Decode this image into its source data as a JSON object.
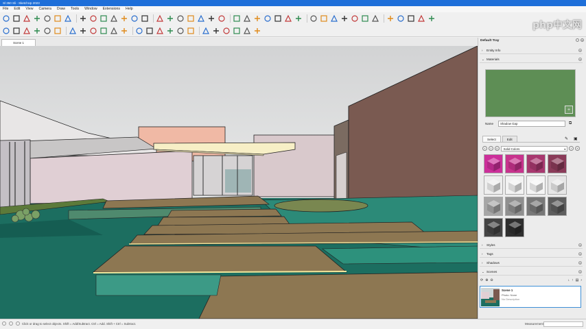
{
  "window": {
    "title": "Sl 350 Sli - SketchUp 2023"
  },
  "menu": [
    "File",
    "Edit",
    "View",
    "Camera",
    "Draw",
    "Tools",
    "Window",
    "Extensions",
    "Help"
  ],
  "toolbar1_icons": [
    "select-icon",
    "paint-icon",
    "eraser-icon",
    "line-icon",
    "arc-icon",
    "rectangle-icon",
    "push-pull-icon",
    "move-icon",
    "rotate-icon",
    "scale-icon",
    "offset-icon",
    "tape-icon",
    "text-icon",
    "orbit-icon",
    "pan-icon",
    "zoom-icon",
    "zoom-extents-icon",
    "walk-icon",
    "position-camera-icon",
    "look-around-icon",
    "section-plane-icon",
    "new-icon",
    "open-icon",
    "save-icon",
    "user-icon",
    "folder-icon",
    "sandbox-icon",
    "eye-icon",
    "water-drop-icon",
    "water-drop-icon",
    "layers-icon",
    "flip-icon",
    "solid-tools-icon",
    "follow-me-icon",
    "intersect-icon",
    "scenes-icon",
    "styles-icon",
    "warehouse-icon",
    "extension-icon",
    "settings-icon"
  ],
  "toolbar2_icons": [
    "brush-icon",
    "camera-icon",
    "component-icon",
    "group-icon",
    "box-icon",
    "iso-view-icon",
    "top-view-icon",
    "front-view-icon",
    "right-view-icon",
    "back-view-icon",
    "left-view-icon",
    "xray-icon",
    "wireframe-icon",
    "hidden-line-icon",
    "shaded-icon",
    "textured-icon",
    "monochrome-icon",
    "geo-icon",
    "help-icon",
    "dot-icon",
    "line-icon",
    "square-icon",
    "circle-icon",
    "no-icon"
  ],
  "scene_tab": "Scene 1",
  "tray": {
    "title": "Default Tray",
    "sections": {
      "entity_info": "Entity Info",
      "materials": "Materials",
      "styles": "Styles",
      "tags": "Tags",
      "shadows": "Shadows",
      "scenes": "Scenes"
    },
    "material": {
      "color": "#5e8e55",
      "name_label": "Name",
      "name_value": "Shadow Gap",
      "tabs": [
        "Select",
        "Edit"
      ],
      "library": "Solid Colors"
    },
    "swatches": [
      "#cc2f9a",
      "#c8338d",
      "#a8386f",
      "#8a3b59",
      "#eeeeee",
      "#f2f2f2",
      "#f4f4f4",
      "#e6e6e6",
      "#a6a6a6",
      "#8f8f8f",
      "#787878",
      "#5e5e5e",
      "#444444",
      "#2f2f2f"
    ],
    "scene": {
      "name": "Scene 1",
      "photo": "Photo: None",
      "desc": "No Description"
    }
  },
  "status": {
    "text": "Click or drag to select objects. Shift = Add/Subtract. Ctrl = Add. Shift + Ctrl = Subtract.",
    "measurements_label": "Measurements"
  },
  "watermark": "php中文网"
}
